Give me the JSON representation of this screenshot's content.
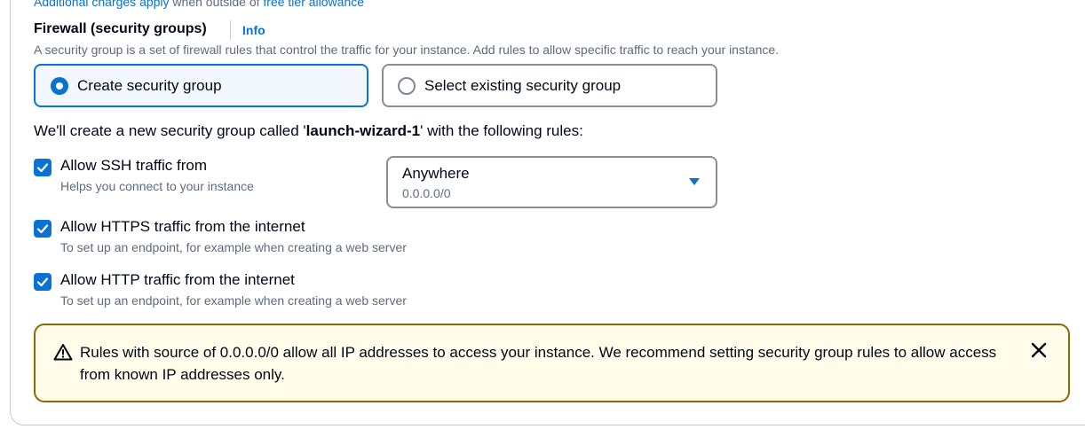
{
  "top_note": {
    "text": "Additional charges apply",
    "middle": " when outside of ",
    "link": "free tier allowance"
  },
  "firewall": {
    "title": "Firewall (security groups)",
    "info_link": "Info",
    "description": "A security group is a set of firewall rules that control the traffic for your instance. Add rules to allow specific traffic to reach your instance.",
    "options": [
      {
        "label": "Create security group",
        "selected": true
      },
      {
        "label": "Select existing security group",
        "selected": false
      }
    ],
    "sentence_prefix": "We'll create a new security group called '",
    "group_name": "launch-wizard-1",
    "sentence_suffix": "' with the following rules:",
    "rules": [
      {
        "label": "Allow SSH traffic from",
        "help": "Helps you connect to your instance",
        "checked": true
      },
      {
        "label": "Allow HTTPS traffic from the internet",
        "help": "To set up an endpoint, for example when creating a web server",
        "checked": true
      },
      {
        "label": "Allow HTTP traffic from the internet",
        "help": "To set up an endpoint, for example when creating a web server",
        "checked": true
      }
    ],
    "ssh_source": {
      "value": "Anywhere",
      "description": "0.0.0.0/0"
    },
    "alert": {
      "message": "Rules with source of 0.0.0.0/0 allow all IP addresses to access your instance. We recommend setting security group rules to allow access from known IP addresses only."
    }
  },
  "icons": {
    "warning": "warning-icon",
    "close": "close-icon",
    "caret": "caret-down-icon",
    "check": "check-icon"
  },
  "colors": {
    "accent": "#0972d3",
    "text": "#000716",
    "secondary_text": "#5f6b7a",
    "warning_border": "#8d6605",
    "warning_bg": "#fffce9"
  }
}
